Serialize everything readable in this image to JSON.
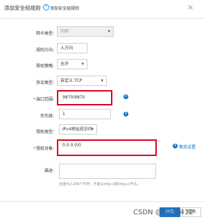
{
  "dialog": {
    "title": "添加安全组规则",
    "help_icon": "?",
    "help_link": "添加安全组规则",
    "close_icon": "×"
  },
  "form": {
    "nic_type": {
      "label": "网卡类型:",
      "value": "内网"
    },
    "direction": {
      "label": "规则方向:",
      "value": "入方向"
    },
    "policy": {
      "label": "授权策略:",
      "value": "允许"
    },
    "protocol": {
      "label": "协议类型:",
      "value": "自定义 TCP"
    },
    "port_range": {
      "required_mark": "*",
      "label": "端口范围:",
      "value": "9870/9870"
    },
    "priority": {
      "label": "优先级:",
      "value": "1"
    },
    "auth_type": {
      "label": "授权类型:",
      "value": "IPv4地址段访问"
    },
    "auth_object": {
      "required_mark": "*",
      "label": "授权对象:",
      "value": "0.0.0.0/0",
      "link": "教我设置"
    },
    "description": {
      "label": "描述:",
      "value": "",
      "hint": "长度为2-256个字符，不能以http://或https://开头。"
    }
  },
  "footer": {
    "confirm": "确定",
    "cancel": "取消"
  },
  "watermark": "CSDN @PRC0412"
}
